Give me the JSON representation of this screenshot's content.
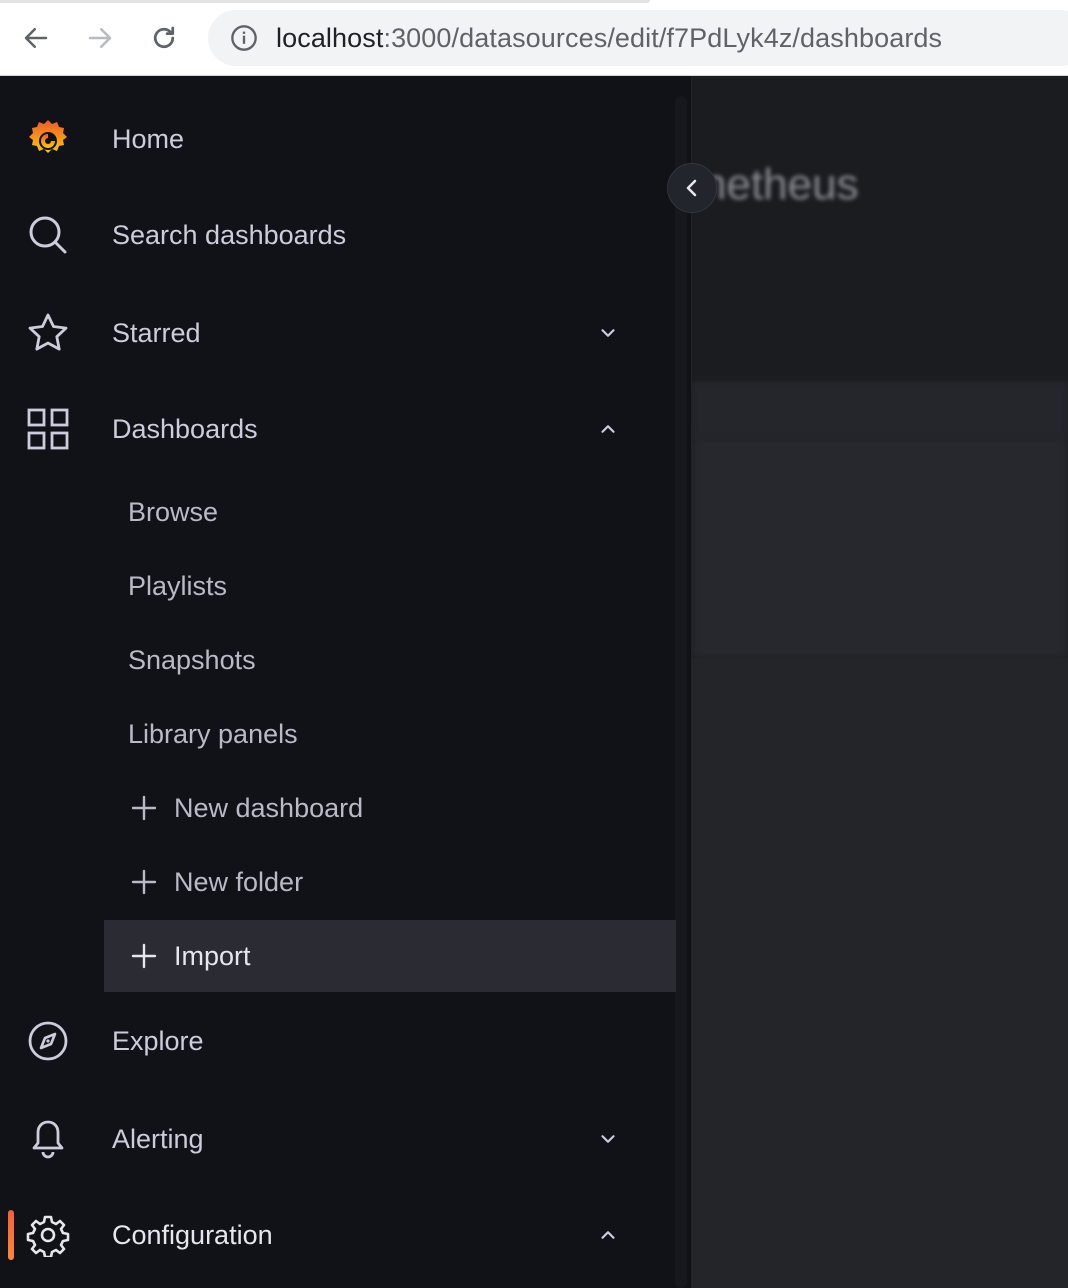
{
  "browser": {
    "url_host": "localhost",
    "url_path": ":3000/datasources/edit/f7PdLyk4z/dashboards"
  },
  "sidebar": {
    "items": [
      {
        "label": "Home",
        "icon": "grafana-logo-icon"
      },
      {
        "label": "Search dashboards",
        "icon": "search-icon"
      },
      {
        "label": "Starred",
        "icon": "star-icon",
        "expanded": false
      },
      {
        "label": "Dashboards",
        "icon": "apps-icon",
        "expanded": true
      },
      {
        "label": "Explore",
        "icon": "compass-icon"
      },
      {
        "label": "Alerting",
        "icon": "bell-icon",
        "expanded": false
      },
      {
        "label": "Configuration",
        "icon": "cog-icon",
        "expanded": true,
        "active": true
      }
    ],
    "dashboards_children": [
      {
        "label": "Browse"
      },
      {
        "label": "Playlists"
      },
      {
        "label": "Snapshots"
      },
      {
        "label": "Library panels"
      },
      {
        "label": "New dashboard",
        "icon": "plus-icon"
      },
      {
        "label": "New folder",
        "icon": "plus-icon"
      },
      {
        "label": "Import",
        "icon": "plus-icon",
        "selected": true
      }
    ]
  },
  "main": {
    "title_fragment": "netheus"
  },
  "colors": {
    "sidebar_bg": "#111217",
    "text": "#ccccdc",
    "selected_bg": "#2a2b33",
    "accent": "#f55f3e"
  }
}
